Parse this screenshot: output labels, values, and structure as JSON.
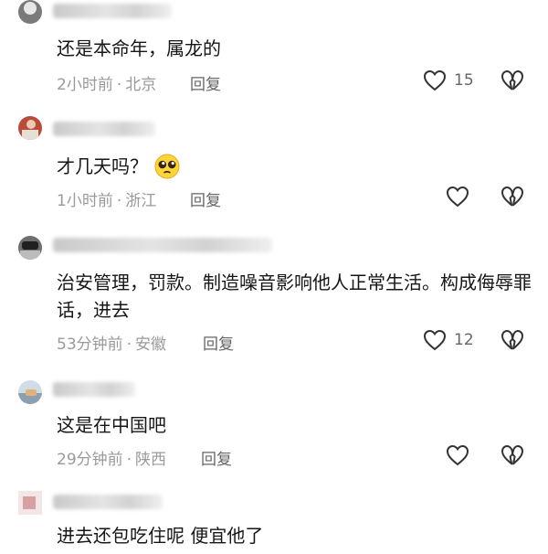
{
  "comments": [
    {
      "text": "还是本命年，属龙的",
      "time": "2小时前",
      "location": "北京",
      "reply": "回复",
      "likes": "15"
    },
    {
      "text": "才几天吗？",
      "time": "1小时前",
      "location": "浙江",
      "reply": "回复",
      "likes": ""
    },
    {
      "text": "治安管理，罚款。制造噪音影响他人正常生活。构成侮辱罪话，进去",
      "time": "53分钟前",
      "location": "安徽",
      "reply": "回复",
      "likes": "12"
    },
    {
      "text": "这是在中国吧",
      "time": "29分钟前",
      "location": "陕西",
      "reply": "回复",
      "likes": ""
    },
    {
      "text": "进去还包吃住呢 便宜他了"
    }
  ],
  "icons": {
    "like": "heart-outline-icon",
    "dislike": "broken-heart-icon",
    "emoji": "pleading-face-emoji-icon"
  },
  "meta_separator": "·"
}
